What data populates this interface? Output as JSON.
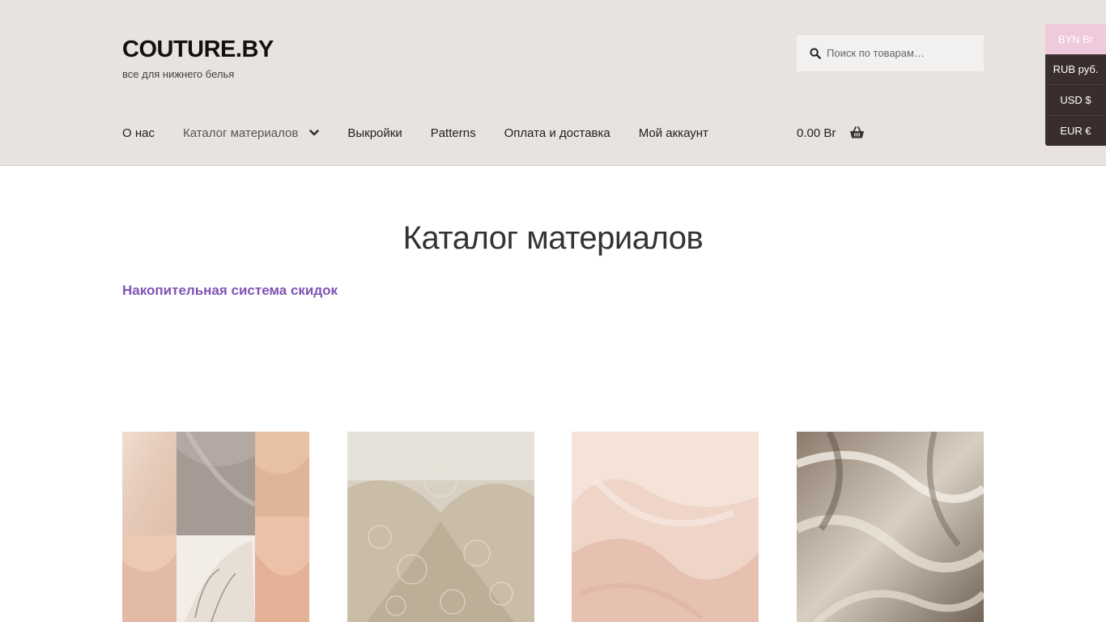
{
  "header": {
    "site_title": "COUTURE.BY",
    "tagline": "все для нижнего белья",
    "search_placeholder": "Поиск по товарам…"
  },
  "nav": {
    "items": [
      {
        "label": "О нас"
      },
      {
        "label": "Каталог материалов",
        "has_dropdown": true,
        "active": true
      },
      {
        "label": "Выкройки"
      },
      {
        "label": "Patterns"
      },
      {
        "label": "Оплата и доставка"
      },
      {
        "label": "Мой аккаунт"
      }
    ]
  },
  "cart": {
    "total": "0.00 Br",
    "icon": "basket-icon"
  },
  "currency_switcher": {
    "items": [
      "BYN Br",
      "RUB руб.",
      "USD $",
      "EUR €"
    ],
    "selected": "BYN Br"
  },
  "main": {
    "page_title": "Каталог материалов",
    "promo_link": "Накопительная система скидок"
  },
  "colors": {
    "header_bg": "#e8e3df",
    "accent_link": "#7f54b3",
    "currency_bg": "#3a2e2c",
    "currency_active": "#efc9dc"
  }
}
